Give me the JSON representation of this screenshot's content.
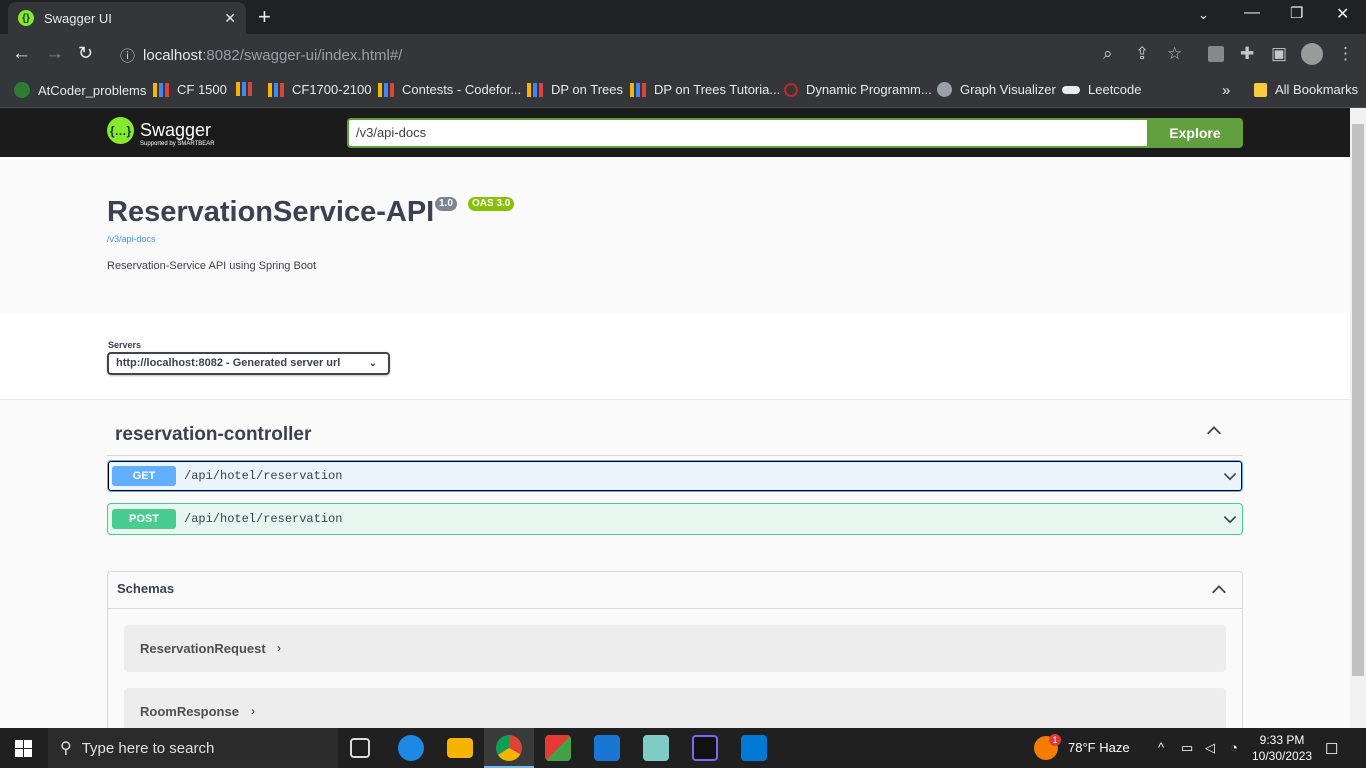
{
  "browser": {
    "tab_title": "Swagger UI",
    "url_host": "localhost",
    "url_rest": ":8082/swagger-ui/index.html#/",
    "bookmarks": [
      {
        "label": "AtCoder_problems"
      },
      {
        "label": "CF 1500"
      },
      {
        "label": "CF1700-2100"
      },
      {
        "label": "Contests - Codefor..."
      },
      {
        "label": "DP on Trees"
      },
      {
        "label": "DP on Trees Tutoria..."
      },
      {
        "label": "Dynamic Programm..."
      },
      {
        "label": "Graph Visualizer"
      },
      {
        "label": "Leetcode"
      }
    ],
    "all_bookmarks": "All Bookmarks"
  },
  "swagger": {
    "logo_text": "Swagger",
    "logo_sub": "Supported by SMARTBEAR",
    "spec_url": "/v3/api-docs",
    "explore_label": "Explore",
    "title": "ReservationService-API",
    "version": "1.0",
    "oas": "OAS 3.0",
    "spec_link": "/v3/api-docs",
    "description": "Reservation-Service API using Spring Boot",
    "servers_label": "Servers",
    "server_selected": "http://localhost:8082 - Generated server url",
    "tag": "reservation-controller",
    "operations": [
      {
        "method": "GET",
        "path": "/api/hotel/reservation"
      },
      {
        "method": "POST",
        "path": "/api/hotel/reservation"
      }
    ],
    "schemas_title": "Schemas",
    "schemas": [
      "ReservationRequest",
      "RoomResponse"
    ]
  },
  "taskbar": {
    "search_placeholder": "Type here to search",
    "weather": "78°F  Haze",
    "weather_badge": "1",
    "time": "9:33 PM",
    "date": "10/30/2023"
  },
  "colors": {
    "swagger_green": "#85ea2d",
    "get": "#61affe",
    "post": "#49cc90",
    "explore": "#62a03f"
  }
}
